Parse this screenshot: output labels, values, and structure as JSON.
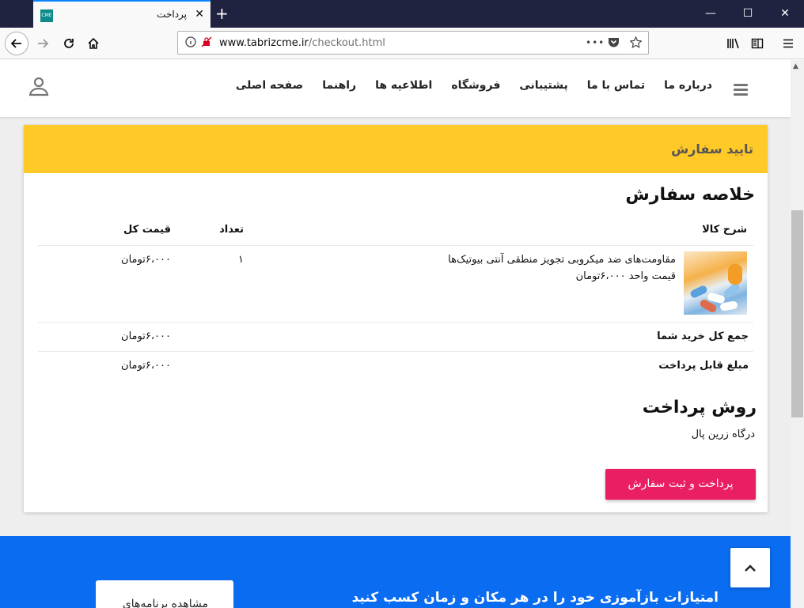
{
  "browser": {
    "tab_title": "پرداخت",
    "tab_favicon_text": "CME",
    "tab_close": "✕",
    "new_tab": "+",
    "minimize": "—",
    "maximize": "☐",
    "close_window": "✕",
    "url_host": "www.tabrizcme.ir",
    "url_path": "/checkout.html",
    "page_actions": "•••"
  },
  "header": {
    "menu": [
      "صفحه اصلی",
      "راهنما",
      "اطلاعیه ها",
      "فروشگاه",
      "پشتیبانی",
      "تماس با ما",
      "درباره ما"
    ]
  },
  "checkout": {
    "card_title": "تایید سفارش",
    "summary_title": "خلاصه سفارش",
    "columns": {
      "description": "شرح کالا",
      "quantity": "تعداد",
      "total": "قیمت کل"
    },
    "item": {
      "name": "مقاومت‌های ضد میکروبی تجویز منطقی آنتی بیوتیک‌ها",
      "unit_price": "قیمت واحد ۶،۰۰۰تومان",
      "quantity": "۱",
      "total": "۶،۰۰۰تومان"
    },
    "subtotal_label": "جمع کل خرید شما",
    "subtotal_value": "۶،۰۰۰تومان",
    "payable_label": "مبلغ قابل پرداخت",
    "payable_value": "۶،۰۰۰تومان",
    "payment_title": "روش پرداخت",
    "gateway": "درگاه زرین پال",
    "submit_label": "پرداخت و ثبت سفارش"
  },
  "footer": {
    "slogan": "امتیازات بازآموزی خود را در هر مکان و زمان کسب کنید",
    "card_text": "مشاهده برنامه‌های"
  },
  "colors": {
    "card_header": "#ffc927",
    "submit_button": "#e91e63",
    "footer_band": "#0a6cf0",
    "browser_tabbar": "#202340"
  }
}
